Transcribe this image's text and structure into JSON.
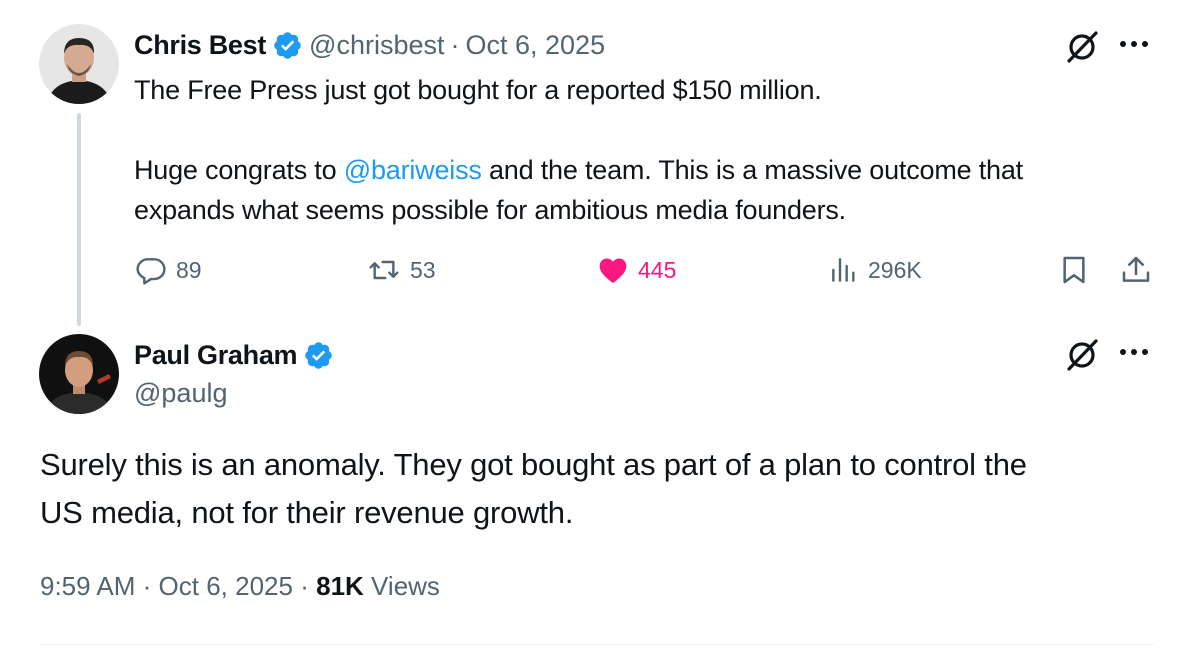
{
  "parent_tweet": {
    "author_name": "Chris Best",
    "handle": "@chrisbest",
    "separator": "·",
    "date": "Oct 6, 2025",
    "text_line1": "The Free Press just got bought for a reported $150 million.",
    "text_pre_mention": "Huge congrats to ",
    "mention": "@bariweiss",
    "text_post_mention": " and the team. This is a massive outcome that",
    "text_line3": "expands what seems possible for ambitious media founders.",
    "replies": "89",
    "reposts": "53",
    "likes": "445",
    "views": "296K",
    "like_color": "#f91880"
  },
  "main_tweet": {
    "author_name": "Paul Graham",
    "handle": "@paulg",
    "text_line1": "Surely this is an anomaly. They got bought as part of a plan to control the",
    "text_line2": "US media, not for their revenue growth.",
    "time": "9:59 AM",
    "separator": "·",
    "date": "Oct 6, 2025",
    "views_count": "81K",
    "views_label": "Views"
  },
  "colors": {
    "accent": "#1d9bf0",
    "text": "#0f1419",
    "secondary": "#536471"
  }
}
